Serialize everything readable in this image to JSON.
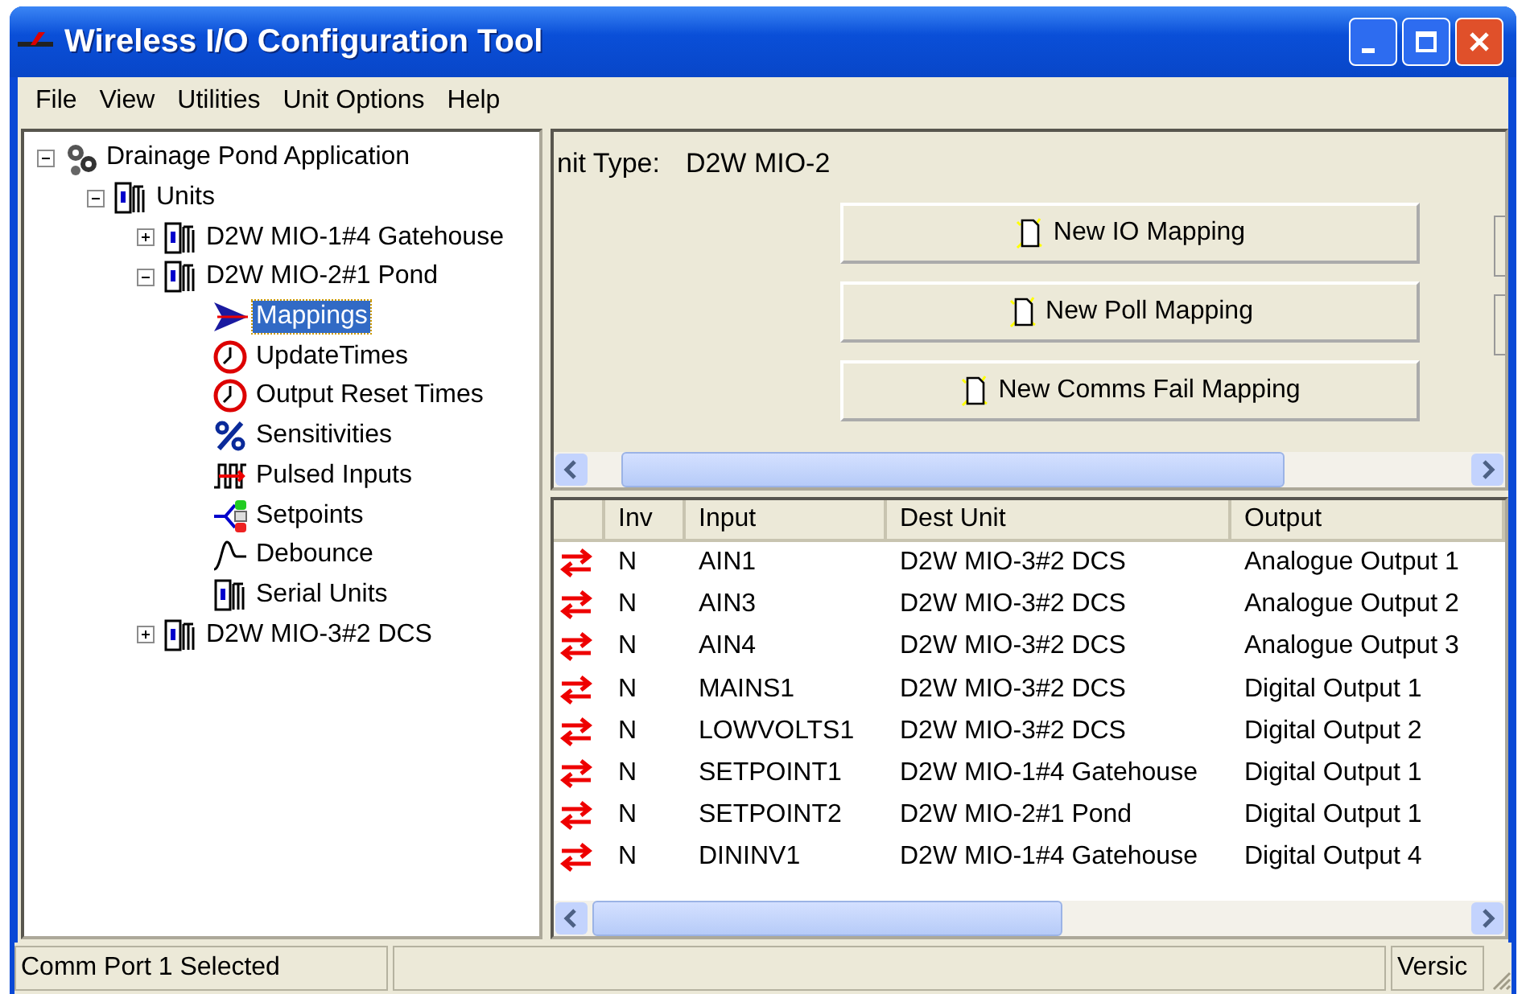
{
  "window": {
    "title": "Wireless I/O Configuration Tool"
  },
  "menu": [
    "File",
    "View",
    "Utilities",
    "Unit Options",
    "Help"
  ],
  "tree": [
    {
      "label": "Drainage Pond Application",
      "kind": "app",
      "expanded": true,
      "selected": false,
      "children": [
        {
          "label": "Units",
          "kind": "unit",
          "expanded": true,
          "selected": false,
          "children": [
            {
              "label": "D2W MIO-1#4 Gatehouse",
              "kind": "unit",
              "expanded": false,
              "selected": false
            },
            {
              "label": "D2W MIO-2#1 Pond",
              "kind": "unit",
              "expanded": true,
              "selected": false,
              "children": [
                {
                  "label": "Mappings",
                  "kind": "mapping",
                  "selected": true
                },
                {
                  "label": "UpdateTimes",
                  "kind": "clock",
                  "selected": false
                },
                {
                  "label": "Output Reset Times",
                  "kind": "clock",
                  "selected": false
                },
                {
                  "label": "Sensitivities",
                  "kind": "percent",
                  "selected": false
                },
                {
                  "label": "Pulsed Inputs",
                  "kind": "pulse",
                  "selected": false
                },
                {
                  "label": "Setpoints",
                  "kind": "setpoint",
                  "selected": false
                },
                {
                  "label": "Debounce",
                  "kind": "wave",
                  "selected": false
                },
                {
                  "label": "Serial Units",
                  "kind": "unit",
                  "selected": false
                }
              ]
            },
            {
              "label": "D2W MIO-3#2 DCS",
              "kind": "unit",
              "expanded": false,
              "selected": false
            }
          ]
        }
      ]
    }
  ],
  "unit_type": {
    "label": "nit Type:",
    "value": "D2W MIO-2"
  },
  "buttons": [
    "New IO Mapping",
    "New Poll Mapping",
    "New Comms Fail Mapping"
  ],
  "table": {
    "columns": [
      "Inv",
      "Input",
      "Dest Unit",
      "Output"
    ],
    "rows": [
      [
        "N",
        "AIN1",
        "D2W MIO-3#2 DCS",
        "Analogue Output 1"
      ],
      [
        "N",
        "AIN3",
        "D2W MIO-3#2 DCS",
        "Analogue Output 2"
      ],
      [
        "N",
        "AIN4",
        "D2W MIO-3#2 DCS",
        "Analogue Output 3"
      ],
      [
        "N",
        "MAINS1",
        "D2W MIO-3#2 DCS",
        "Digital Output 1"
      ],
      [
        "N",
        "LOWVOLTS1",
        "D2W MIO-3#2 DCS",
        "Digital Output 2"
      ],
      [
        "N",
        "SETPOINT1",
        "D2W MIO-1#4 Gatehouse",
        "Digital Output 1"
      ],
      [
        "N",
        "SETPOINT2",
        "D2W MIO-2#1 Pond",
        "Digital Output 1"
      ],
      [
        "N",
        "DININV1",
        "D2W MIO-1#4 Gatehouse",
        "Digital Output 4"
      ]
    ]
  },
  "status_bar": {
    "message": "Comm Port 1 Selected",
    "version": "Versic"
  }
}
